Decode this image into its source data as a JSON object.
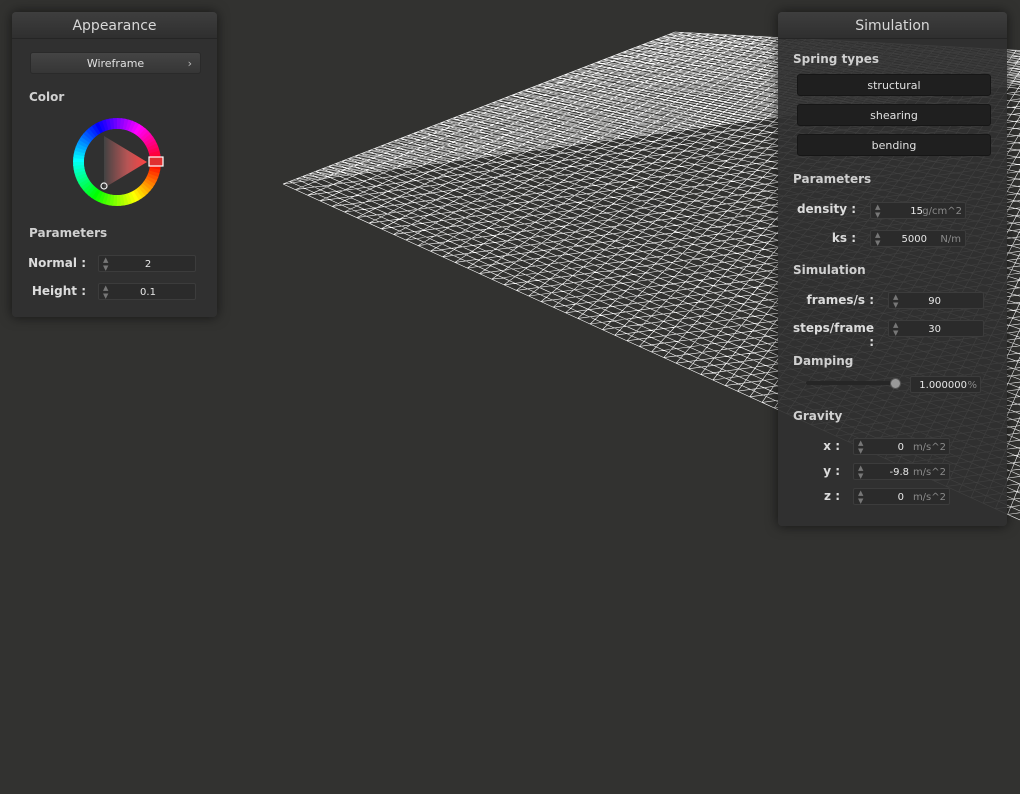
{
  "appearance_panel": {
    "title": "Appearance",
    "render_mode": "Wireframe",
    "render_mode_arrow": "›",
    "color_label": "Color",
    "parameters_label": "Parameters",
    "normal_label": "Normal :",
    "normal_value": "2",
    "height_label": "Height :",
    "height_value": "0.1",
    "color_wheel_icon": "color-wheel-icon"
  },
  "simulation_panel": {
    "title": "Simulation",
    "spring_types_label": "Spring types",
    "spring_buttons": [
      "structural",
      "shearing",
      "bending"
    ],
    "parameters_label": "Parameters",
    "density_label": "density :",
    "density_value": "15",
    "density_unit": "g/cm^2",
    "ks_label": "ks :",
    "ks_value": "5000",
    "ks_unit": "N/m",
    "simulation_label": "Simulation",
    "fps_label": "frames/s :",
    "fps_value": "90",
    "steps_label": "steps/frame :",
    "steps_value": "30",
    "damping_label": "Damping",
    "damping_value": "1.000000",
    "damping_unit": "%",
    "gravity_label": "Gravity",
    "gx_label": "x :",
    "gx_value": "0",
    "gy_label": "y :",
    "gy_value": "-9.8",
    "gz_label": "z :",
    "gz_value": "0",
    "gravity_unit": "m/s^2"
  },
  "colors": {
    "background": "#323230",
    "wireframe": "#ffffff",
    "panel": "#303030"
  }
}
